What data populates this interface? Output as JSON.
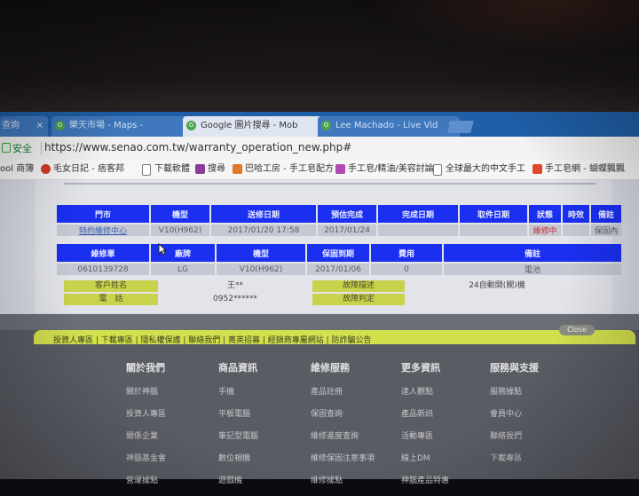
{
  "browser": {
    "tabs": [
      {
        "label": "查詢",
        "icon": ""
      },
      {
        "label": "樂天市場 - Maps -",
        "icon": "G"
      },
      {
        "label": "Google 圖片搜尋 - Mob",
        "icon": "G"
      },
      {
        "label": "Lee Machado - Live Vid",
        "icon": "G"
      }
    ],
    "tab_close": "×",
    "secure_label": "安全",
    "url": "https://www.senao.com.tw/warranty_operation_new.php#",
    "bookmarks": [
      {
        "label": "ool 商簿",
        "color": "#4b6fb0"
      },
      {
        "label": "毛女日記 - 痞客邦",
        "color": "#d33a2c"
      },
      {
        "label": "下載軟體",
        "color": "#2d6cc6"
      },
      {
        "label": "搜尋",
        "color": "#8a3c9a"
      },
      {
        "label": "巴哈工房 - 手工皂配方",
        "color": "#e07a2a"
      },
      {
        "label": "手工皂/精油/美容討論",
        "color": "#b04ab0"
      },
      {
        "label": "全球最大的中文手工",
        "color": "#666666"
      },
      {
        "label": "手工皂網 - 蝴蝶飄飄",
        "color": "#e04a2a"
      }
    ]
  },
  "table1": {
    "headers": [
      "門市",
      "機型",
      "送修日期",
      "預估完成",
      "完成日期",
      "取件日期",
      "狀態",
      "時效",
      "備註"
    ],
    "row": [
      "特約維修中心",
      "V10(H962)",
      "2017/01/20 17:58",
      "2017/01/24",
      "",
      "",
      "維修中",
      "",
      "保固內"
    ]
  },
  "table2": {
    "headers": [
      "維修單",
      "廠牌",
      "機型",
      "保固到期",
      "費用",
      "備註"
    ],
    "row": [
      "0610139728",
      "LG",
      "V10(H962)",
      "2017/01/06",
      "0",
      "電池"
    ]
  },
  "info": {
    "customer_label": "客戶姓名",
    "customer_value": "王**",
    "phone_label": "電　話",
    "phone_value": "0952******",
    "fault_label": "故障描述",
    "fault_value": "24自動開(關)機",
    "judge_label": "故障判定",
    "judge_value": ""
  },
  "footer": {
    "links": "投資人專區 | 下載專區 | 隱私權保護 | 聯絡我們 | 菁英招募 | 經銷商專屬網站 | 防詐騙公告",
    "close_label": "Close",
    "columns": [
      {
        "heading": "關於我們",
        "items": [
          "關於神腦",
          "投資人專區",
          "關係企業",
          "神腦基金會",
          "營運據點"
        ]
      },
      {
        "heading": "商品資訊",
        "items": [
          "手機",
          "平板電腦",
          "筆記型電腦",
          "數位相機",
          "遊戲機"
        ]
      },
      {
        "heading": "維修服務",
        "items": [
          "產品註冊",
          "保固查詢",
          "維修進度查詢",
          "維修保固注意事項",
          "維修據點"
        ]
      },
      {
        "heading": "更多資訊",
        "items": [
          "達人觀點",
          "產品新訊",
          "活動專區",
          "線上DM",
          "神腦產品特惠"
        ]
      },
      {
        "heading": "服務與支援",
        "items": [
          "服務據點",
          "會員中心",
          "聯絡我們",
          "下載專區"
        ]
      }
    ]
  }
}
